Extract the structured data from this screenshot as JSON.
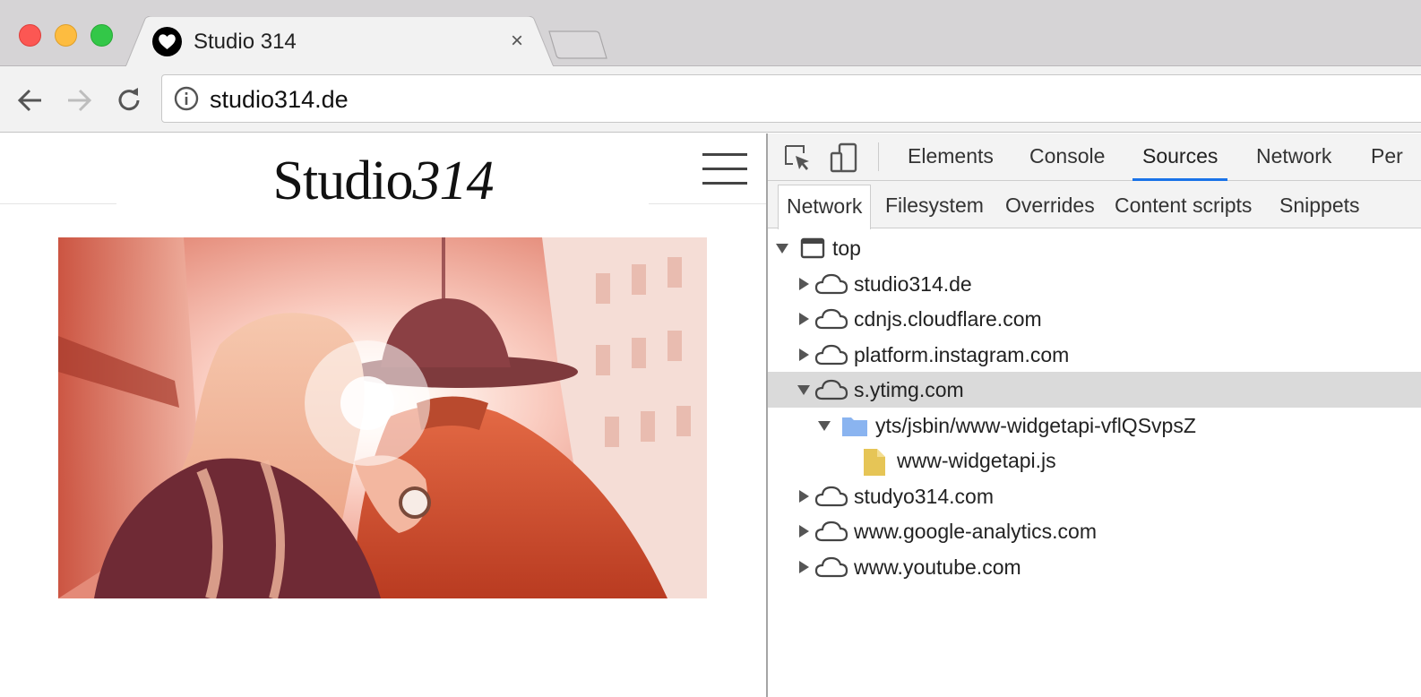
{
  "browser": {
    "tab": {
      "title": "Studio 314",
      "close_symbol": "×"
    },
    "toolbar": {
      "url": "studio314.de"
    }
  },
  "site": {
    "logo_word": "Studio",
    "logo_number": "314"
  },
  "devtools": {
    "main_tabs": [
      {
        "label": "Elements"
      },
      {
        "label": "Console"
      },
      {
        "label": "Sources",
        "active": true
      },
      {
        "label": "Network"
      },
      {
        "label": "Per"
      }
    ],
    "sub_tabs": [
      {
        "label": "Network",
        "active": true
      },
      {
        "label": "Filesystem"
      },
      {
        "label": "Overrides"
      },
      {
        "label": "Content scripts"
      },
      {
        "label": "Snippets"
      }
    ],
    "tree": [
      {
        "label": "top",
        "icon": "frame-icon",
        "expanded": true
      },
      {
        "label": "studio314.de",
        "icon": "cloud-icon",
        "expanded": false
      },
      {
        "label": "cdnjs.cloudflare.com",
        "icon": "cloud-icon",
        "expanded": false
      },
      {
        "label": "platform.instagram.com",
        "icon": "cloud-icon",
        "expanded": false
      },
      {
        "label": "s.ytimg.com",
        "icon": "cloud-icon",
        "expanded": true,
        "selected": true
      },
      {
        "label": "yts/jsbin/www-widgetapi-vflQSvpsZ",
        "icon": "folder-icon",
        "expanded": true
      },
      {
        "label": "www-widgetapi.js",
        "icon": "file-icon"
      },
      {
        "label": "studyo314.com",
        "icon": "cloud-icon",
        "expanded": false
      },
      {
        "label": "www.google-analytics.com",
        "icon": "cloud-icon",
        "expanded": false
      },
      {
        "label": "www.youtube.com",
        "icon": "cloud-icon",
        "expanded": false
      }
    ]
  },
  "colors": {
    "close": "#fc5753",
    "minimize": "#fdbc40",
    "maximize": "#33c748",
    "active_tab_underline": "#1a73e8",
    "folder": "#8ab4f0",
    "file": "#e6c556"
  }
}
